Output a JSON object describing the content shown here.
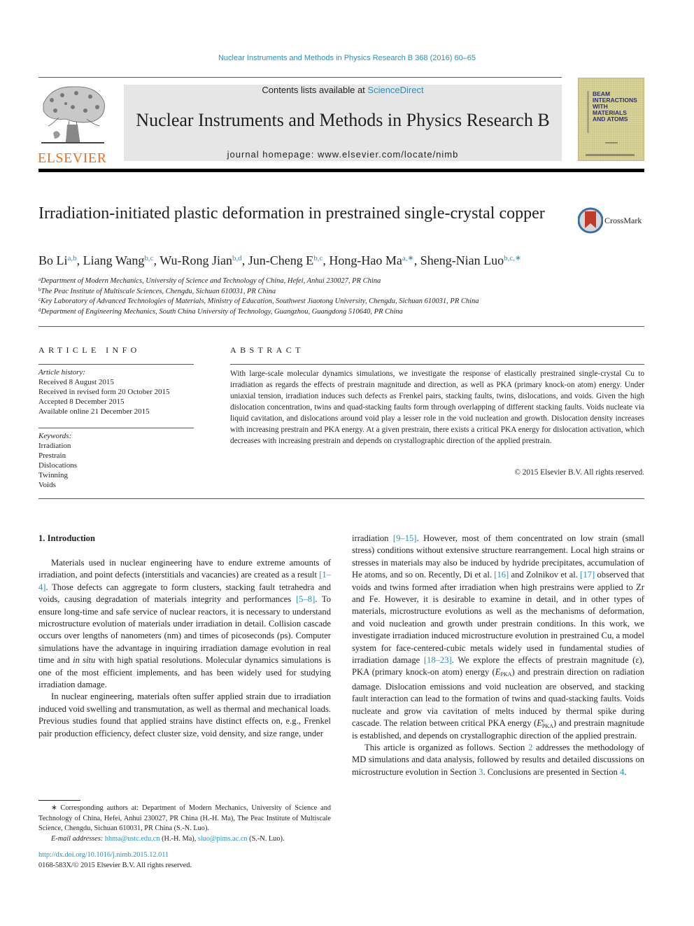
{
  "running_head": "Nuclear Instruments and Methods in Physics Research B 368 (2016) 60–65",
  "masthead": {
    "publisher_logo_text": "ELSEVIER",
    "contents_prefix": "Contents lists available at ",
    "contents_link": "ScienceDirect",
    "journal_title": "Nuclear Instruments and Methods in Physics Research B",
    "homepage_prefix": "journal homepage: ",
    "homepage_url": "www.elsevier.com/locate/nimb",
    "cover_text": "BEAM\nINTERACTIONS\nWITH\nMATERIALS\nAND ATOMS"
  },
  "article": {
    "title": "Irradiation-initiated plastic deformation in prestrained single-crystal copper",
    "crossmark_label": "CrossMark",
    "authors": [
      {
        "name": "Bo Li",
        "aff": "a,b"
      },
      {
        "name": "Liang Wang",
        "aff": "b,c"
      },
      {
        "name": "Wu-Rong Jian",
        "aff": "b,d"
      },
      {
        "name": "Jun-Cheng E",
        "aff": "b,c"
      },
      {
        "name": "Hong-Hao Ma",
        "aff": "a,∗"
      },
      {
        "name": "Sheng-Nian Luo",
        "aff": "b,c,∗"
      }
    ],
    "affiliations": [
      {
        "key": "a",
        "text": "Department of Modern Mechanics, University of Science and Technology of China, Hefei, Anhui 230027, PR China"
      },
      {
        "key": "b",
        "text": "The Peac Institute of Multiscale Sciences, Chengdu, Sichuan 610031, PR China"
      },
      {
        "key": "c",
        "text": "Key Laboratory of Advanced Technologies of Materials, Ministry of Education, Southwest Jiaotong University, Chengdu, Sichuan 610031, PR China"
      },
      {
        "key": "d",
        "text": "Department of Engineering Mechanics, South China University of Technology, Guangzhou, Guangdong 510640, PR China"
      }
    ]
  },
  "article_info": {
    "heading": "ARTICLE INFO",
    "history_label": "Article history:",
    "history": [
      "Received 8 August 2015",
      "Received in revised form 20 October 2015",
      "Accepted 8 December 2015",
      "Available online 21 December 2015"
    ],
    "keywords_label": "Keywords:",
    "keywords": [
      "Irradiation",
      "Prestrain",
      "Dislocations",
      "Twinning",
      "Voids"
    ]
  },
  "abstract": {
    "heading": "ABSTRACT",
    "text": "With large-scale molecular dynamics simulations, we investigate the response of elastically prestrained single-crystal Cu to irradiation as regards the effects of prestrain magnitude and direction, as well as PKA (primary knock-on atom) energy. Under uniaxial tension, irradiation induces such defects as Frenkel pairs, stacking faults, twins, dislocations, and voids. Given the high dislocation concentration, twins and quad-stacking faults form through overlapping of different stacking faults. Voids nucleate via liquid cavitation, and dislocations around void play a lesser role in the void nucleation and growth. Dislocation density increases with increasing prestrain and PKA energy. At a given prestrain, there exists a critical PKA energy for dislocation activation, which decreases with increasing prestrain and depends on crystallographic direction of the applied prestrain.",
    "copyright": "© 2015 Elsevier B.V. All rights reserved."
  },
  "intro": {
    "heading": "1. Introduction",
    "left": {
      "p1_a": "Materials used in nuclear engineering have to endure extreme amounts of irradiation, and point defects (interstitials and vacancies) are created as a result ",
      "p1_ref1": "[1–4]",
      "p1_b": ". Those defects can aggregate to form clusters, stacking fault tetrahedra and voids, causing degradation of materials integrity and performances ",
      "p1_ref2": "[5–8]",
      "p1_c": ". To ensure long-time and safe service of nuclear reactors, it is necessary to understand microstructure evolution of materials under irradiation in detail. Collision cascade occurs over lengths of nanometers (nm) and times of picoseconds (ps). Computer simulations have the advantage in inquiring irradiation damage evolution in real time and ",
      "p1_italic": "in situ",
      "p1_d": " with high spatial resolutions. Molecular dynamics simulations is one of the most efficient implements, and has been widely used for studying irradiation damage.",
      "p2": "In nuclear engineering, materials often suffer applied strain due to irradiation induced void swelling and transmutation, as well as thermal and mechanical loads. Previous studies found that applied strains have distinct effects on, e.g., Frenkel pair production efficiency, defect cluster size, void density, and size range, under"
    },
    "right": {
      "a": "irradiation ",
      "ref1": "[9–15]",
      "b": ". However, most of them concentrated on low strain (small stress) conditions without extensive structure rearrangement. Local high strains or stresses in materials may also be induced by hydride precipitates, accumulation of He atoms, and so on. Recently, Di et al. ",
      "ref2": "[16]",
      "c": " and Zolnikov et al. ",
      "ref3": "[17]",
      "d": " observed that voids and twins formed after irradiation when high prestrains were applied to Zr and Fe. However, it is desirable to examine in detail, and in other types of materials, microstructure evolutions as well as the mechanisms of deformation, and void nucleation and growth under prestrain conditions. In this work, we investigate irradiation induced microstructure evolution in prestrained Cu, a model system for face-centered-cubic metals widely used in fundamental studies of irradiation damage ",
      "ref4": "[18–23]",
      "e": ". We explore the effects of prestrain magnitude (ε), PKA (primary knock-on atom) energy (",
      "e_sym": "E",
      "e_sub": "PKA",
      "f": ") and prestrain direction on radiation damage. Dislocation emissions and void nucleation are observed, and stacking fault interaction can lead to the formation of twins and quad-stacking faults. Voids nucleate and grow via cavitation of melts induced by thermal spike during cascade. The relation between critical PKA energy (",
      "f_sup": "c",
      "g": ") and prestrain magnitude is established, and depends on crystallographic direction of the applied prestrain.",
      "p2_a": "This article is organized as follows. Section ",
      "p2_ref1": "2",
      "p2_b": " addresses the methodology of MD simulations and data analysis, followed by results and detailed discussions on microstructure evolution in Section ",
      "p2_ref2": "3",
      "p2_c": ". Conclusions are presented in Section ",
      "p2_ref3": "4",
      "p2_d": "."
    }
  },
  "footnote": {
    "corresponding": "∗ Corresponding authors at: Department of Modern Mechanics, University of Science and Technology of China, Hefei, Anhui 230027, PR China (H.-H. Ma), The Peac Institute of Multiscale Science, Chengdu, Sichuan 610031, PR China (S.-N. Luo).",
    "email_label": "E-mail addresses:",
    "email1": "hhma@ustc.edu.cn",
    "email1_who": " (H.-H. Ma), ",
    "email2": "sluo@pims.ac.cn",
    "email2_who": " (S.-N. Luo)."
  },
  "bottom": {
    "doi": "http://dx.doi.org/10.1016/j.nimb.2015.12.011",
    "issn": "0168-583X/© 2015 Elsevier B.V. All rights reserved."
  }
}
